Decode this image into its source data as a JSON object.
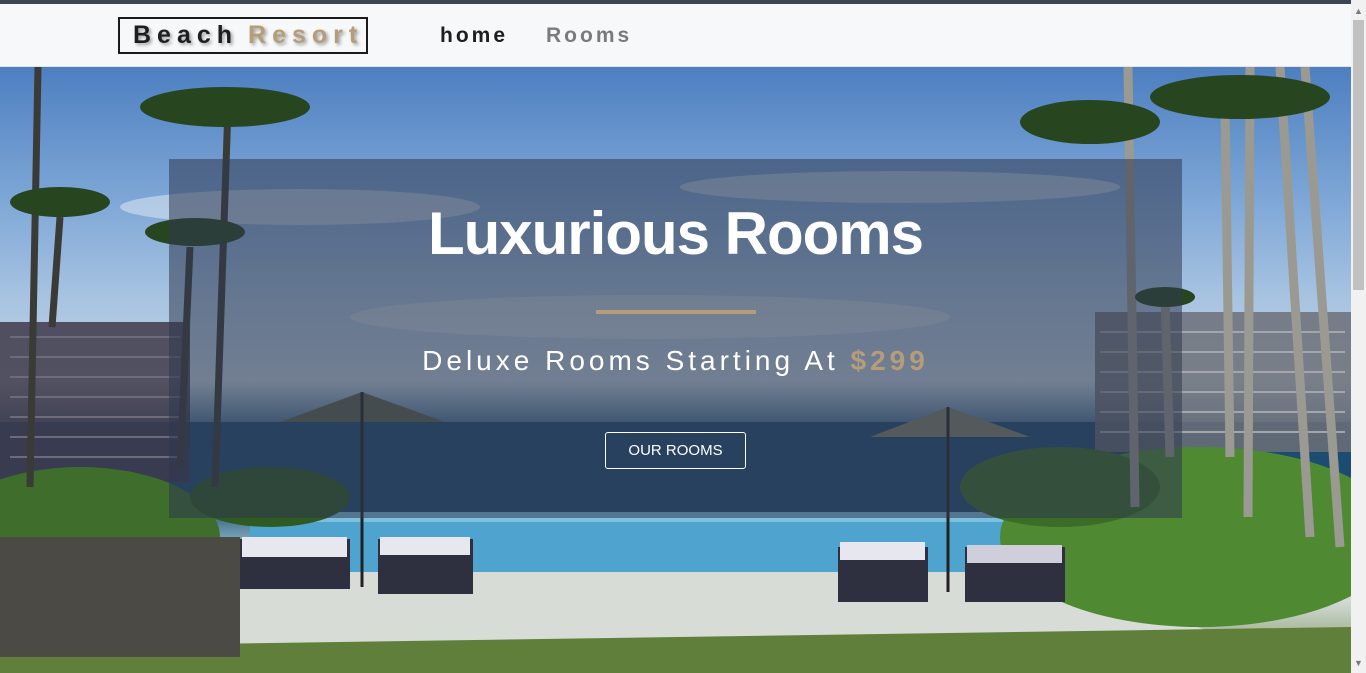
{
  "brand": {
    "part1": "Beach",
    "part2": "Resort",
    "accent_color": "#b59d7a"
  },
  "nav": {
    "links": [
      {
        "label": "home"
      },
      {
        "label": "Rooms"
      }
    ]
  },
  "hero": {
    "title": "Luxurious Rooms",
    "subtitle_prefix": "Deluxe Rooms Starting At",
    "price": "$299",
    "button_label": "OUR ROOMS"
  },
  "icons": {
    "scroll_up": "triangle-up",
    "scroll_down": "triangle-down"
  }
}
